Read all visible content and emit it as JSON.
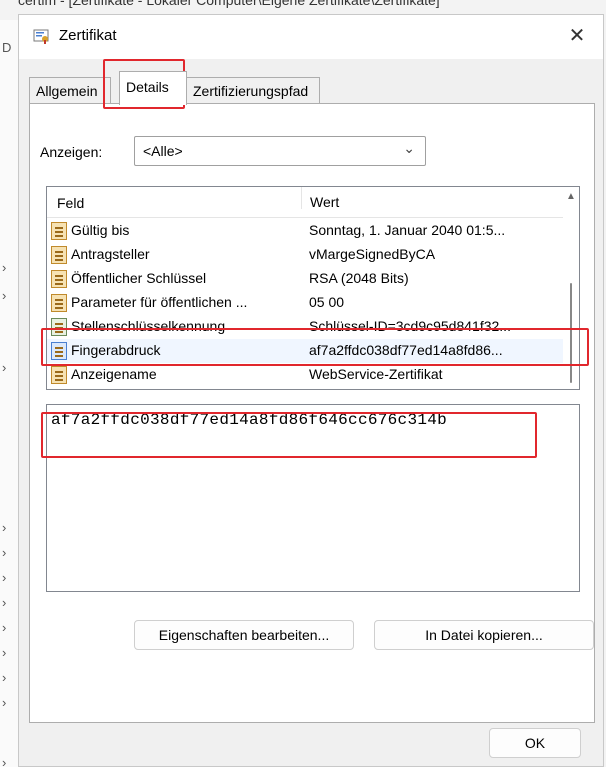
{
  "background": {
    "window_title": "certlm - [Zertifikate - Lokaler Computer\\Eigene Zertifikate\\Zertifikate]",
    "left_marks": [
      "D",
      "›",
      "›",
      "›",
      "›",
      "›",
      "›",
      "›",
      "›",
      "›",
      "›",
      "›",
      "›"
    ]
  },
  "dialog": {
    "title": "Zertifikat",
    "close_glyph": "✕",
    "title_icon": "certificate-icon"
  },
  "tabs": [
    {
      "label": "Allgemein",
      "active": false
    },
    {
      "label": "Details",
      "active": true
    },
    {
      "label": "Zertifizierungspfad",
      "active": false
    }
  ],
  "show": {
    "label": "Anzeigen:",
    "selected": "<Alle>",
    "chevron": "⌄"
  },
  "list": {
    "columns": {
      "field": "Feld",
      "value": "Wert"
    },
    "rows": [
      {
        "field": "Gültig bis",
        "value": "Sonntag, 1. Januar 2040 01:5...",
        "icon": "property-icon"
      },
      {
        "field": "Antragsteller",
        "value": "vMargeSignedByCA",
        "icon": "property-icon"
      },
      {
        "field": "Öffentlicher Schlüssel",
        "value": "RSA (2048 Bits)",
        "icon": "property-icon"
      },
      {
        "field": "Parameter für öffentlichen ...",
        "value": "05 00",
        "icon": "property-icon"
      },
      {
        "field": "Stellenschlüsselkennung",
        "value": "Schlüssel-ID=3cd9c95d841f32...",
        "icon": "extension-icon"
      },
      {
        "field": "Fingerabdruck",
        "value": "af7a2ffdc038df77ed14a8fd86...",
        "icon": "property-icon"
      },
      {
        "field": "Anzeigename",
        "value": "WebService-Zertifikat",
        "icon": "property-icon"
      }
    ]
  },
  "value_box": {
    "text": "af7a2ffdc038df77ed14a8fd86f646cc676c314b"
  },
  "buttons": {
    "edit": "Eigenschaften bearbeiten...",
    "copy": "In Datei kopieren...",
    "ok": "OK"
  },
  "colors": {
    "highlight": "#e1272d",
    "dialog_bg": "#f0f0f0"
  }
}
